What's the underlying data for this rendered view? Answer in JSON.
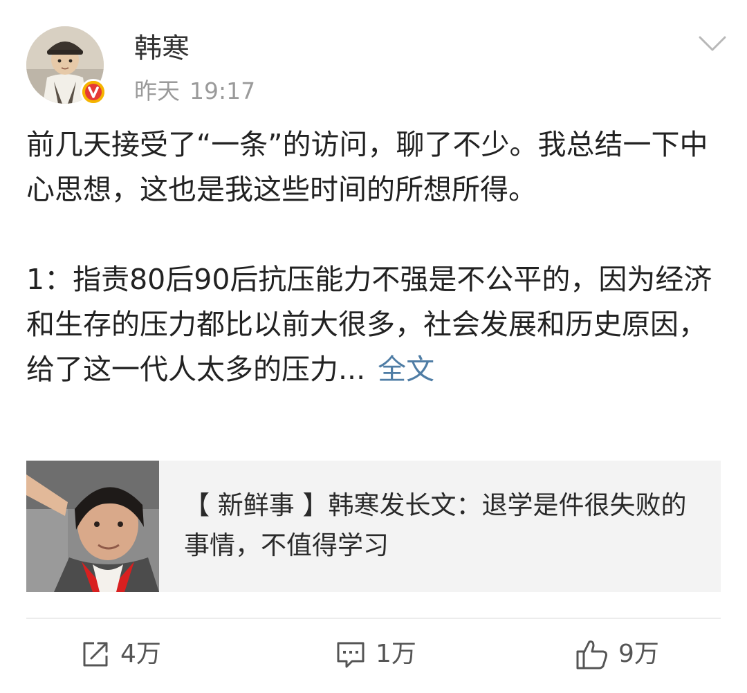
{
  "header": {
    "username": "韩寒",
    "date": "昨天",
    "time": "19:17",
    "more_icon": "chevron-down-icon",
    "verified_icon": "verified-v-badge-icon",
    "verified_color": "#f5b400"
  },
  "post": {
    "paragraph_1": "前几天接受了“一条”的访问，聊了不少。我总结一下中心思想，这也是我这些时间的所想所得。",
    "paragraph_2": "1：指责80后90后抗压能力不强是不公平的，因为经济和生存的压力都比以前大很多，社会发展和历史原因，给了这一代人太多的压力...",
    "expand_label": "全文",
    "link_color": "#4f7da5"
  },
  "card": {
    "title": "【 新鲜事 】韩寒发长文：退学是件很失败的事情，不值得学习"
  },
  "actions": {
    "repost": {
      "icon": "repost-icon",
      "count": "4万"
    },
    "comment": {
      "icon": "comment-icon",
      "count": "1万"
    },
    "like": {
      "icon": "thumbs-up-icon",
      "count": "9万"
    }
  }
}
